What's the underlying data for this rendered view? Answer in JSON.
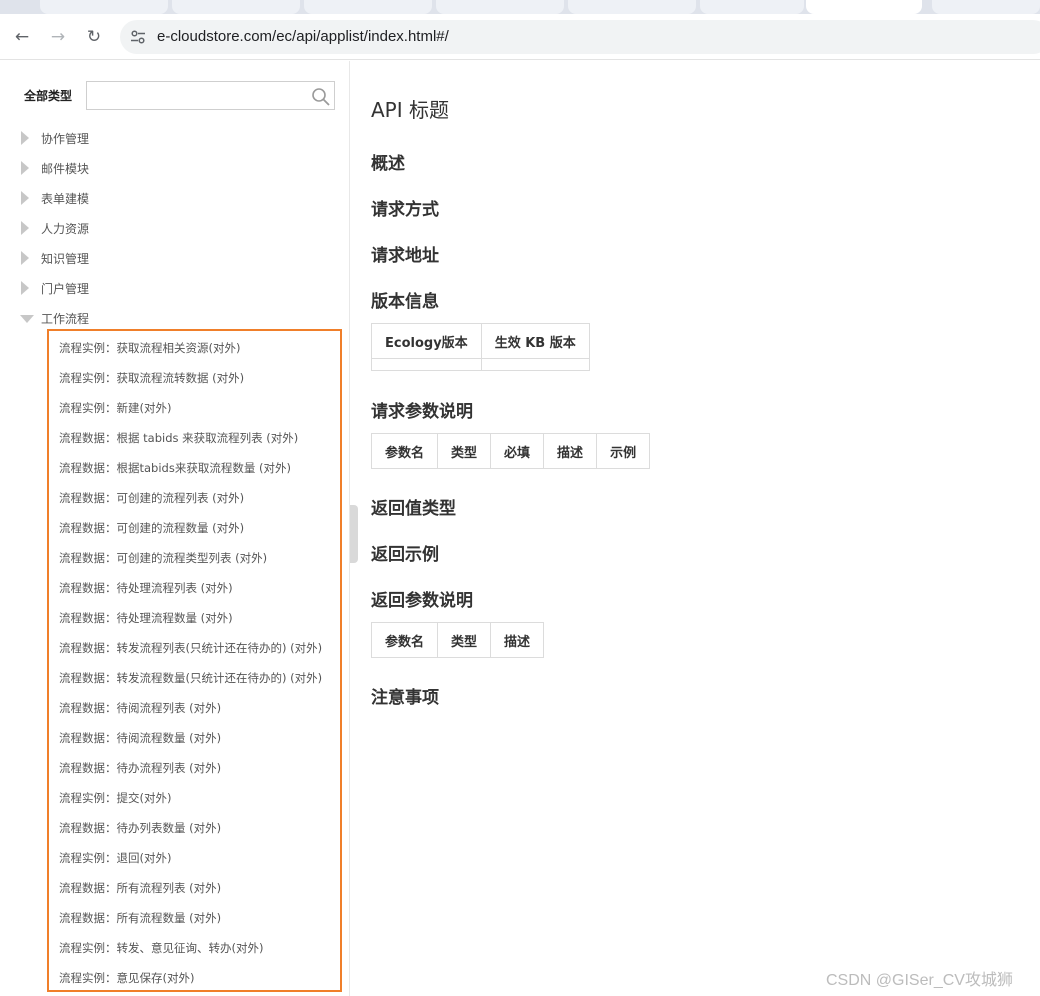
{
  "browser": {
    "url": "e-cloudstore.com/ec/api/applist/index.html#/"
  },
  "sidebar": {
    "filter_label": "全部类型",
    "filter_value": "",
    "categories": [
      {
        "label": "协作管理",
        "expanded": false
      },
      {
        "label": "邮件模块",
        "expanded": false
      },
      {
        "label": "表单建模",
        "expanded": false
      },
      {
        "label": "人力资源",
        "expanded": false
      },
      {
        "label": "知识管理",
        "expanded": false
      },
      {
        "label": "门户管理",
        "expanded": false
      },
      {
        "label": "工作流程",
        "expanded": true
      }
    ],
    "workflow_items": [
      "流程实例：获取流程相关资源(对外)",
      "流程实例：获取流程流转数据 (对外)",
      "流程实例：新建(对外)",
      "流程数据：根据 tabids 来获取流程列表 (对外)",
      "流程数据：根据tabids来获取流程数量 (对外)",
      "流程数据：可创建的流程列表 (对外)",
      "流程数据：可创建的流程数量 (对外)",
      "流程数据：可创建的流程类型列表 (对外)",
      "流程数据：待处理流程列表 (对外)",
      "流程数据：待处理流程数量 (对外)",
      "流程数据：转发流程列表(只统计还在待办的) (对外)",
      "流程数据：转发流程数量(只统计还在待办的) (对外)",
      "流程数据：待阅流程列表 (对外)",
      "流程数据：待阅流程数量 (对外)",
      "流程数据：待办流程列表 (对外)",
      "流程实例：提交(对外)",
      "流程数据：待办列表数量 (对外)",
      "流程实例：退回(对外)",
      "流程数据：所有流程列表 (对外)",
      "流程数据：所有流程数量 (对外)",
      "流程实例：转发、意见征询、转办(对外)",
      "流程实例：意见保存(对外)"
    ]
  },
  "content": {
    "title": "API 标题",
    "overview": "概述",
    "request_method": "请求方式",
    "request_url": "请求地址",
    "version_info": "版本信息",
    "version_table": [
      "Ecology版本",
      "生效 KB 版本"
    ],
    "request_params": "请求参数说明",
    "request_params_table": [
      "参数名",
      "类型",
      "必填",
      "描述",
      "示例"
    ],
    "return_type": "返回值类型",
    "return_example": "返回示例",
    "return_params": "返回参数说明",
    "return_params_table": [
      "参数名",
      "类型",
      "描述"
    ],
    "notes": "注意事项"
  },
  "watermark": "CSDN @GISer_CV攻城狮",
  "colors": {
    "highlight_border": "#f07f2a"
  }
}
